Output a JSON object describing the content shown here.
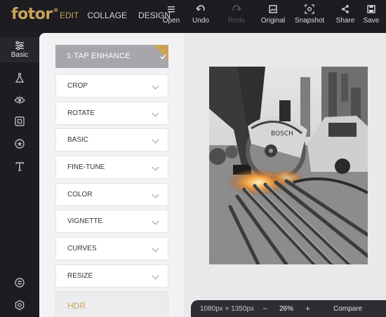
{
  "brand": {
    "logo": "fotor",
    "mark": "®",
    "accent": "#c9a356"
  },
  "modes": [
    {
      "label": "EDIT",
      "active": true
    },
    {
      "label": "COLLAGE",
      "active": false
    },
    {
      "label": "DESIGN",
      "active": false
    }
  ],
  "toolbar": {
    "open": "Open",
    "undo": "Undo",
    "redo": "Redo",
    "original": "Original",
    "snapshot": "Snapshot",
    "share": "Share",
    "save": "Save"
  },
  "leftnav": {
    "basic": "Basic",
    "icons": [
      "sliders-icon",
      "flask-icon",
      "eye-icon",
      "frame-icon",
      "badge-icon",
      "text-icon",
      "settings-circle-icon",
      "gear-icon"
    ]
  },
  "panel": {
    "enhance": "1-TAP ENHANCE",
    "items": [
      "CROP",
      "ROTATE",
      "BASIC",
      "FINE-TUNE",
      "COLOR",
      "VIGNETTE",
      "CURVES",
      "RESIZE"
    ],
    "hdr": "HDR"
  },
  "bottom": {
    "dimensions": "1080px × 1350px",
    "minus": "−",
    "zoom": "26%",
    "plus": "+",
    "compare": "Compare"
  }
}
